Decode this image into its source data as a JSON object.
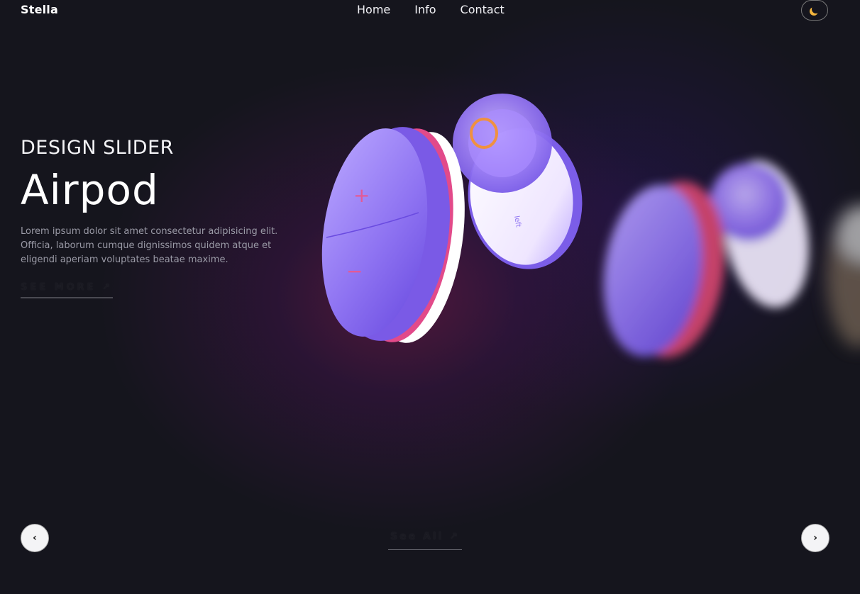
{
  "brand": {
    "name": "Stella"
  },
  "nav": {
    "items": [
      {
        "label": "Home"
      },
      {
        "label": "Info"
      },
      {
        "label": "Contact"
      }
    ]
  },
  "theme_toggle": {
    "icon": "moon-icon"
  },
  "hero": {
    "eyebrow": "DESIGN SLIDER",
    "title": "Airpod",
    "description": "Lorem ipsum dolor sit amet consectetur adipisicing elit. Officia, laborum cumque dignissimos quidem atque et eligendi aperiam voluptates beatae maxime.",
    "cta_label": "SEE MORE ↗"
  },
  "product_labels": {
    "plus": "+",
    "minus": "−",
    "side": "left"
  },
  "controls": {
    "prev_symbol": "‹",
    "next_symbol": "›",
    "see_all_label": "See All ↗"
  },
  "colors": {
    "background": "#15151d",
    "accent_purple": "#8b5cf6",
    "accent_pink": "#e24a8a",
    "moon": "#f3b53d"
  }
}
